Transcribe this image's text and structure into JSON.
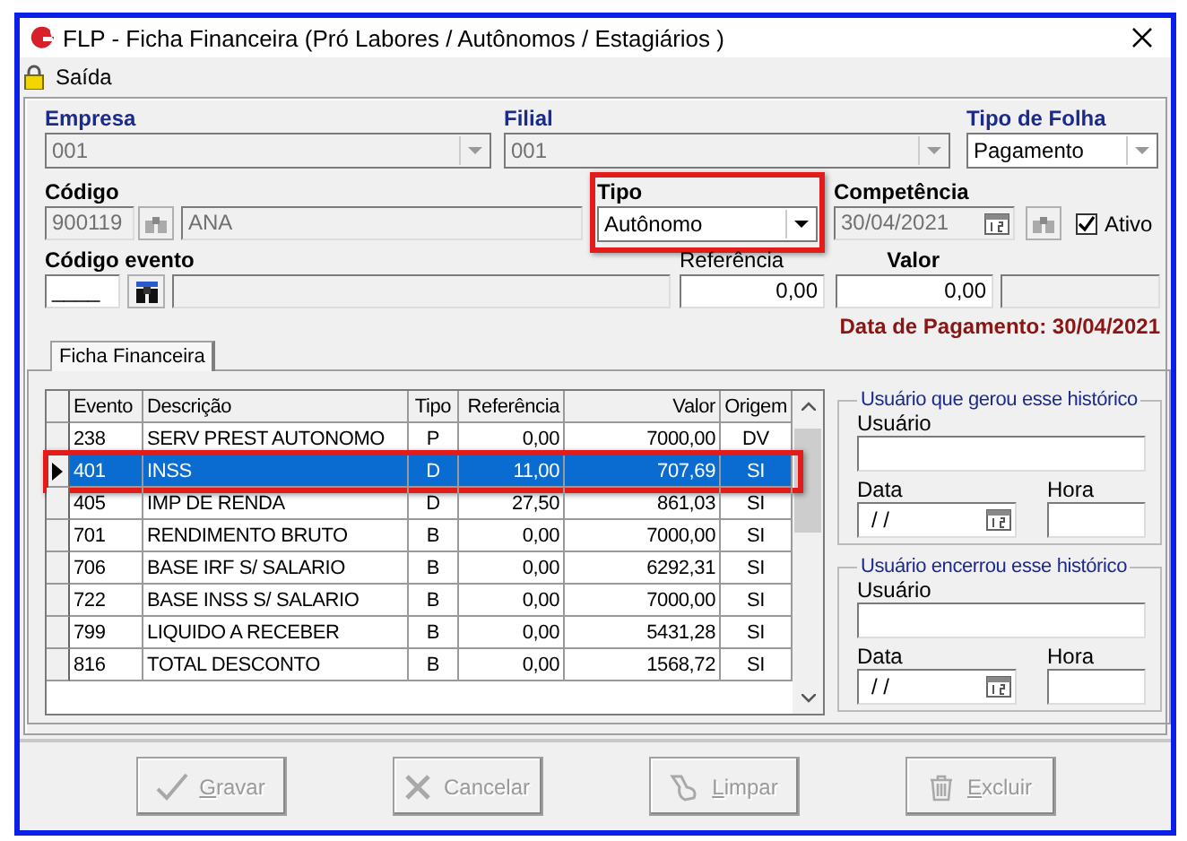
{
  "window": {
    "title": "FLP - Ficha Financeira (Pró Labores / Autônomos / Estagiários )"
  },
  "menu": [
    {
      "label": "Saída"
    }
  ],
  "form": {
    "empresa": {
      "label": "Empresa",
      "value": "001",
      "disabled": true
    },
    "filial": {
      "label": "Filial",
      "value": "001",
      "disabled": true
    },
    "tipo_folha": {
      "label": "Tipo de Folha",
      "value": "Pagamento",
      "disabled": false
    },
    "codigo": {
      "label": "Código",
      "value": "900119",
      "name": "ANA",
      "disabled": true
    },
    "tipo": {
      "label": "Tipo",
      "value": "Autônomo",
      "highlighted": true
    },
    "competencia": {
      "label": "Competência",
      "value": "30/04/2021",
      "disabled": true
    },
    "ativo": {
      "label": "Ativo",
      "checked": true
    },
    "codigo_evento": {
      "label": "Código evento",
      "value": "____"
    },
    "referencia": {
      "label": "Referência",
      "value": "0,00"
    },
    "valor": {
      "label": "Valor",
      "value": "0,00"
    },
    "data_pagamento": "Data de Pagamento: 30/04/2021"
  },
  "tabs": [
    {
      "label": "Ficha Financeira",
      "selected": true
    }
  ],
  "table": {
    "columns": [
      "Evento",
      "Descrição",
      "Tipo",
      "Referência",
      "Valor",
      "Origem"
    ],
    "rows": [
      {
        "cells": [
          "238",
          "SERV PREST AUTONOMO",
          "P",
          "0,00",
          "7000,00",
          "DV"
        ],
        "selected": false,
        "highlighted": false
      },
      {
        "cells": [
          "401",
          "INSS",
          "D",
          "11,00",
          "707,69",
          "SI"
        ],
        "selected": true,
        "highlighted": true
      },
      {
        "cells": [
          "405",
          "IMP DE RENDA",
          "D",
          "27,50",
          "861,03",
          "SI"
        ],
        "selected": false,
        "highlighted": false
      },
      {
        "cells": [
          "701",
          "RENDIMENTO BRUTO",
          "B",
          "0,00",
          "7000,00",
          "SI"
        ],
        "selected": false,
        "highlighted": false
      },
      {
        "cells": [
          "706",
          "BASE IRF S/ SALARIO",
          "B",
          "0,00",
          "6292,31",
          "SI"
        ],
        "selected": false,
        "highlighted": false
      },
      {
        "cells": [
          "722",
          "BASE INSS S/ SALARIO",
          "B",
          "0,00",
          "7000,00",
          "SI"
        ],
        "selected": false,
        "highlighted": false
      },
      {
        "cells": [
          "799",
          "LIQUIDO A RECEBER",
          "B",
          "0,00",
          "5431,28",
          "SI"
        ],
        "selected": false,
        "highlighted": false
      },
      {
        "cells": [
          "816",
          "TOTAL DESCONTO",
          "B",
          "0,00",
          "1568,72",
          "SI"
        ],
        "selected": false,
        "highlighted": false
      }
    ]
  },
  "groups": [
    {
      "title": "Usuário que gerou esse histórico",
      "usuario_label": "Usuário",
      "data_label": "Data",
      "data_value": "/ /",
      "hora_label": "Hora"
    },
    {
      "title": "Usuário encerrou esse histórico",
      "usuario_label": "Usuário",
      "data_label": "Data",
      "data_value": "/ /",
      "hora_label": "Hora"
    }
  ],
  "buttons": [
    {
      "label": "Gravar",
      "kind": "check",
      "disabled": true,
      "mnemonic": true
    },
    {
      "label": "Cancelar",
      "kind": "cross",
      "disabled": true,
      "mnemonic": false
    },
    {
      "label": "Limpar",
      "kind": "broom",
      "disabled": true,
      "mnemonic": true
    },
    {
      "label": "Excluir",
      "kind": "trash",
      "disabled": true,
      "mnemonic": true
    }
  ]
}
